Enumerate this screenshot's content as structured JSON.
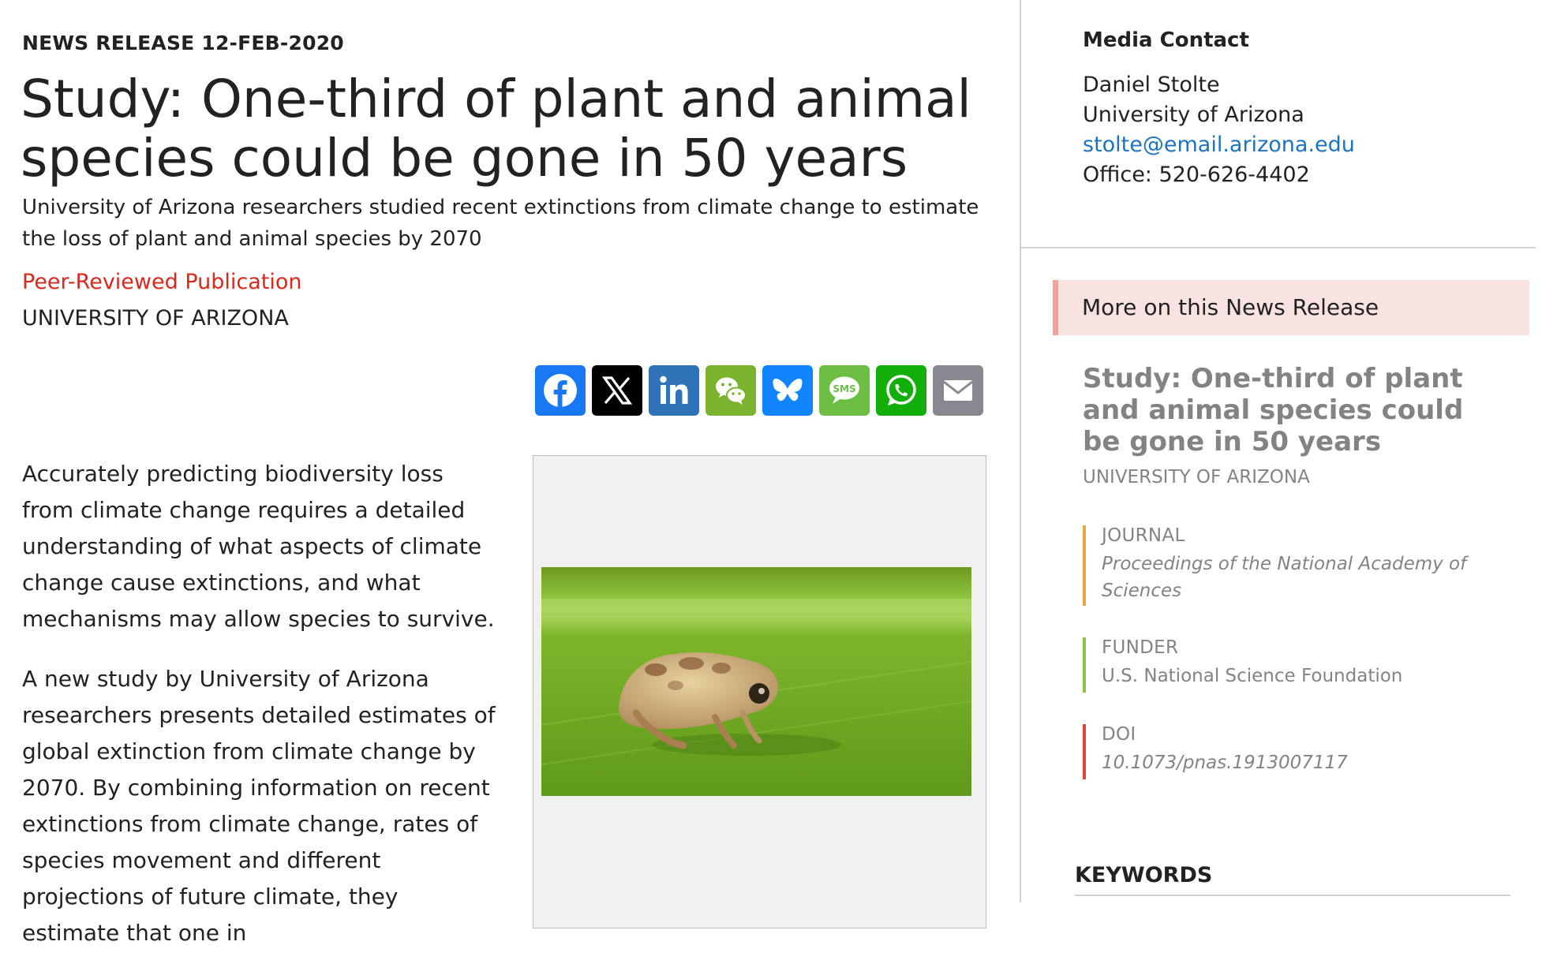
{
  "release": {
    "dateline": "NEWS RELEASE 12-FEB-2020",
    "headline": "Study: One-third of plant and animal species could be gone in 50 years",
    "subhead": "University of Arizona researchers studied recent extinctions from climate change to estimate the loss of plant and animal species by 2070",
    "publication_type": "Peer-Reviewed Publication",
    "institution": "UNIVERSITY OF ARIZONA"
  },
  "share": [
    {
      "name": "Facebook",
      "icon": "facebook-icon",
      "color": "#1877f2"
    },
    {
      "name": "X",
      "icon": "x-icon",
      "color": "#000000"
    },
    {
      "name": "LinkedIn",
      "icon": "linkedin-icon",
      "color": "#2f72b8"
    },
    {
      "name": "WeChat",
      "icon": "wechat-icon",
      "color": "#7bb32e"
    },
    {
      "name": "Bluesky",
      "icon": "bluesky-icon",
      "color": "#1185fe"
    },
    {
      "name": "SMS",
      "icon": "sms-icon",
      "color": "#6cbe45"
    },
    {
      "name": "WhatsApp",
      "icon": "whatsapp-icon",
      "color": "#12af0a"
    },
    {
      "name": "Email",
      "icon": "email-icon",
      "color": "#888990"
    }
  ],
  "article": {
    "paragraphs": [
      "Accurately predicting biodiversity loss from climate change requires a detailed understanding of what aspects of climate change cause extinctions, and what mechanisms may allow species to survive.",
      "A new study by University of Arizona researchers presents detailed estimates of global extinction from climate change by 2070. By combining information on recent extinctions from climate change, rates of species movement and different projections of future climate, they estimate that one in"
    ]
  },
  "sidebar": {
    "media_contact": {
      "label": "Media Contact",
      "name": "Daniel Stolte",
      "org": "University of Arizona",
      "email": "stolte@email.arizona.edu",
      "phone": "Office: 520-626-4402"
    },
    "more": {
      "label": "More on this News Release",
      "title": "Study: One-third of plant and animal species could be gone in 50 years",
      "institution": "UNIVERSITY OF ARIZONA",
      "journal_label": "JOURNAL",
      "journal": "Proceedings of the National Academy of Sciences",
      "funder_label": "FUNDER",
      "funder": "U.S. National Science Foundation",
      "doi_label": "DOI",
      "doi": "10.1073/pnas.1913007117"
    },
    "keywords_label": "KEYWORDS"
  },
  "colors": {
    "accent_red": "#d9291c",
    "link_blue": "#1e73be",
    "journal_bar": "#e8a845",
    "funder_bar": "#8bc34a",
    "doi_bar": "#e0453a"
  }
}
